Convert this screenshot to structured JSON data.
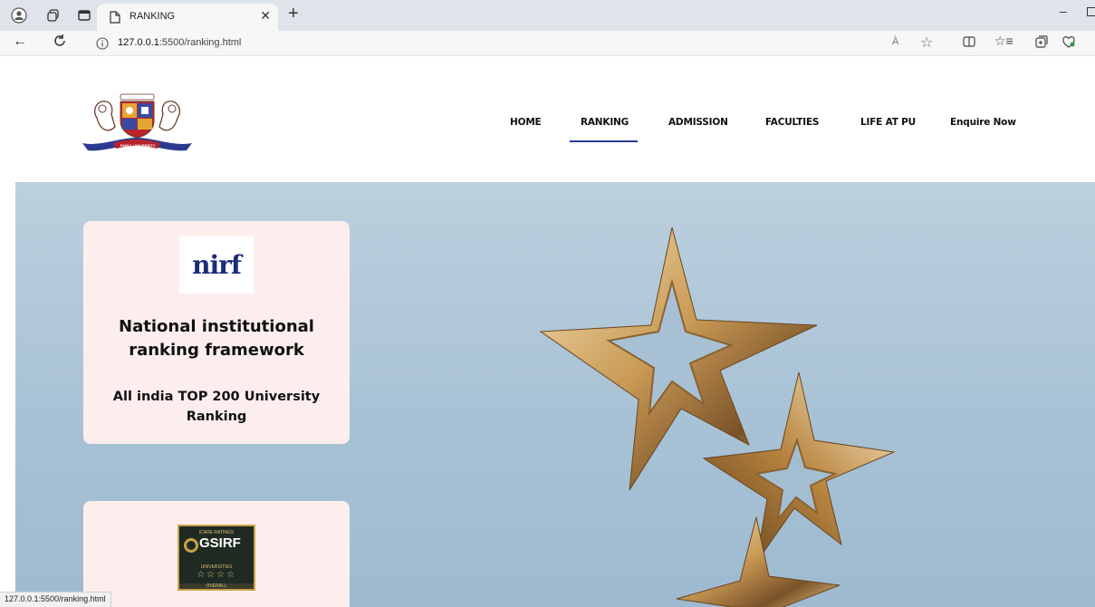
{
  "browser": {
    "tab_title": "RANKING",
    "new_tab_symbol": "+",
    "url_host": "127.0.0.1",
    "url_rest": ":5500/ranking.html",
    "read_aloud_label": "À",
    "status_text": "127.0.0.1:5500/ranking.html"
  },
  "nav": {
    "items": [
      {
        "label": "HOME"
      },
      {
        "label": "RANKING"
      },
      {
        "label": "ADMISSION"
      },
      {
        "label": "FACULTIES"
      },
      {
        "label": "LIFE AT PU"
      },
      {
        "label": "Enquire Now"
      }
    ],
    "active": "RANKING",
    "accent": "#2b3a8f"
  },
  "cards": [
    {
      "logo_text": "nirf",
      "title_line1": "National institutional",
      "title_line2": "ranking framework",
      "subtitle_line1": "All india TOP 200 University",
      "subtitle_line2": "Ranking"
    },
    {
      "logo_top": "ICARE RATINGS",
      "logo_text": "GSIRF",
      "logo_mid": "UNIVERSITIES",
      "logo_bottom": "OVERALL"
    }
  ],
  "logo_text": "PARUL UNIVERSITY"
}
